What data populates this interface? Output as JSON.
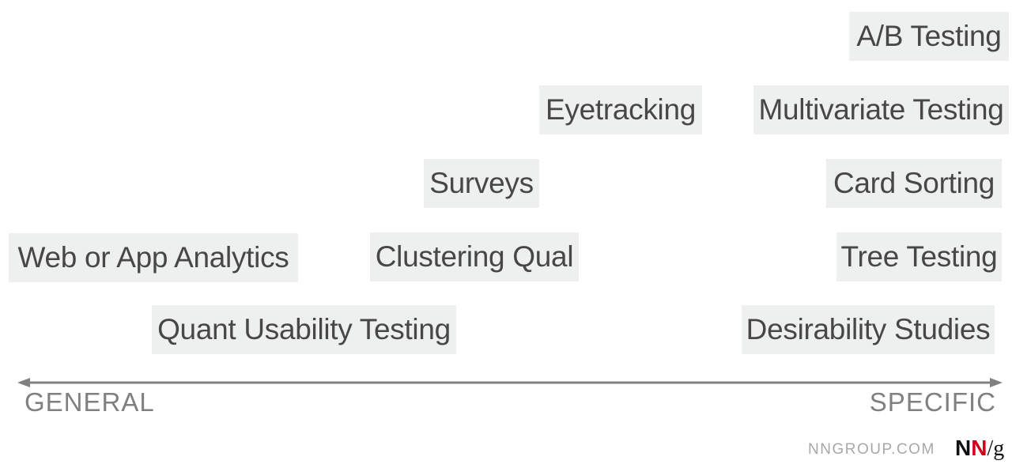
{
  "methods": [
    {
      "id": "ab-testing",
      "label": "A/B Testing"
    },
    {
      "id": "eyetracking",
      "label": "Eyetracking"
    },
    {
      "id": "multivariate-testing",
      "label": "Multivariate Testing"
    },
    {
      "id": "surveys",
      "label": "Surveys"
    },
    {
      "id": "card-sorting",
      "label": "Card Sorting"
    },
    {
      "id": "web-app-analytics",
      "label": "Web or App Analytics"
    },
    {
      "id": "clustering-qual",
      "label": "Clustering Qual"
    },
    {
      "id": "tree-testing",
      "label": "Tree Testing"
    },
    {
      "id": "quant-usability-testing",
      "label": "Quant Usability Testing"
    },
    {
      "id": "desirability-studies",
      "label": "Desirability Studies"
    }
  ],
  "axis": {
    "left_label": "GENERAL",
    "right_label": "SPECIFIC"
  },
  "footer": {
    "site": "NNGROUP.COM",
    "logo_n1": "N",
    "logo_n2": "N",
    "logo_slash": "/",
    "logo_g": "g"
  },
  "colors": {
    "box_bg": "#eeefef",
    "text": "#474747",
    "axis": "#808080",
    "logo_red": "#d0021b"
  }
}
